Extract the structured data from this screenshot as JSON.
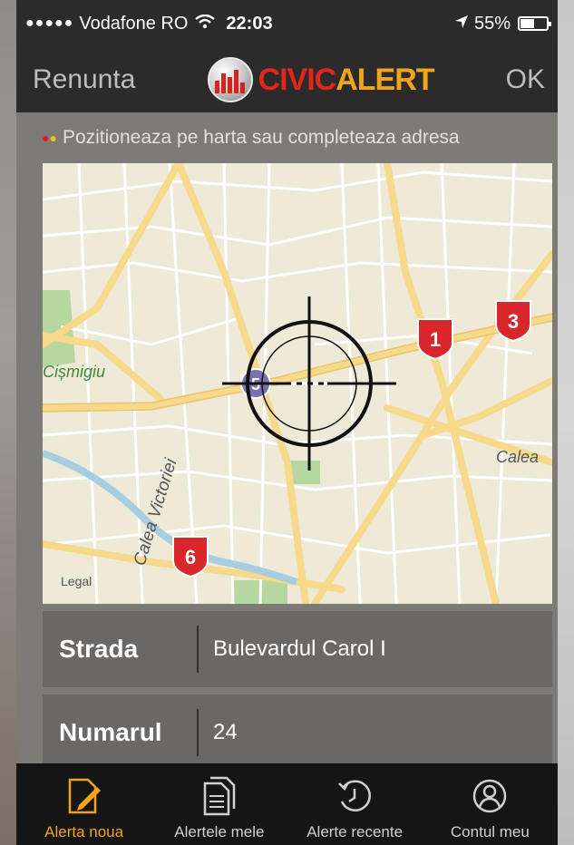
{
  "status_bar": {
    "signal": "●●●●●",
    "carrier": "Vodafone RO",
    "time": "22:03",
    "battery": "55%",
    "battery_level": 0.55
  },
  "nav": {
    "cancel_label": "Renunta",
    "brand_civic": "CIVIC",
    "brand_alert": "ALERT",
    "ok_label": "OK"
  },
  "hint": "Pozitioneaza pe harta sau completeaza adresa",
  "map": {
    "labels": {
      "park": "Cișmigiu",
      "street_victoriei": "Calea Victoriei",
      "street_calea": "Calea",
      "legal": "Legal"
    },
    "markers": [
      "1",
      "3",
      "6"
    ],
    "selected_marker": "5"
  },
  "form": {
    "strada": {
      "label": "Strada",
      "value": "Bulevardul Carol I"
    },
    "numarul": {
      "label": "Numarul",
      "value": "24"
    }
  },
  "tabs": [
    {
      "label": "Alerta noua",
      "icon": "edit-icon",
      "active": true
    },
    {
      "label": "Alertele mele",
      "icon": "documents-icon",
      "active": false
    },
    {
      "label": "Alerte recente",
      "icon": "history-icon",
      "active": false
    },
    {
      "label": "Contul meu",
      "icon": "user-icon",
      "active": false
    }
  ],
  "colors": {
    "brand_red": "#e3251c",
    "brand_orange": "#f2a51b",
    "marker_red": "#d8262b",
    "bar_dark": "#2b2b2b"
  }
}
